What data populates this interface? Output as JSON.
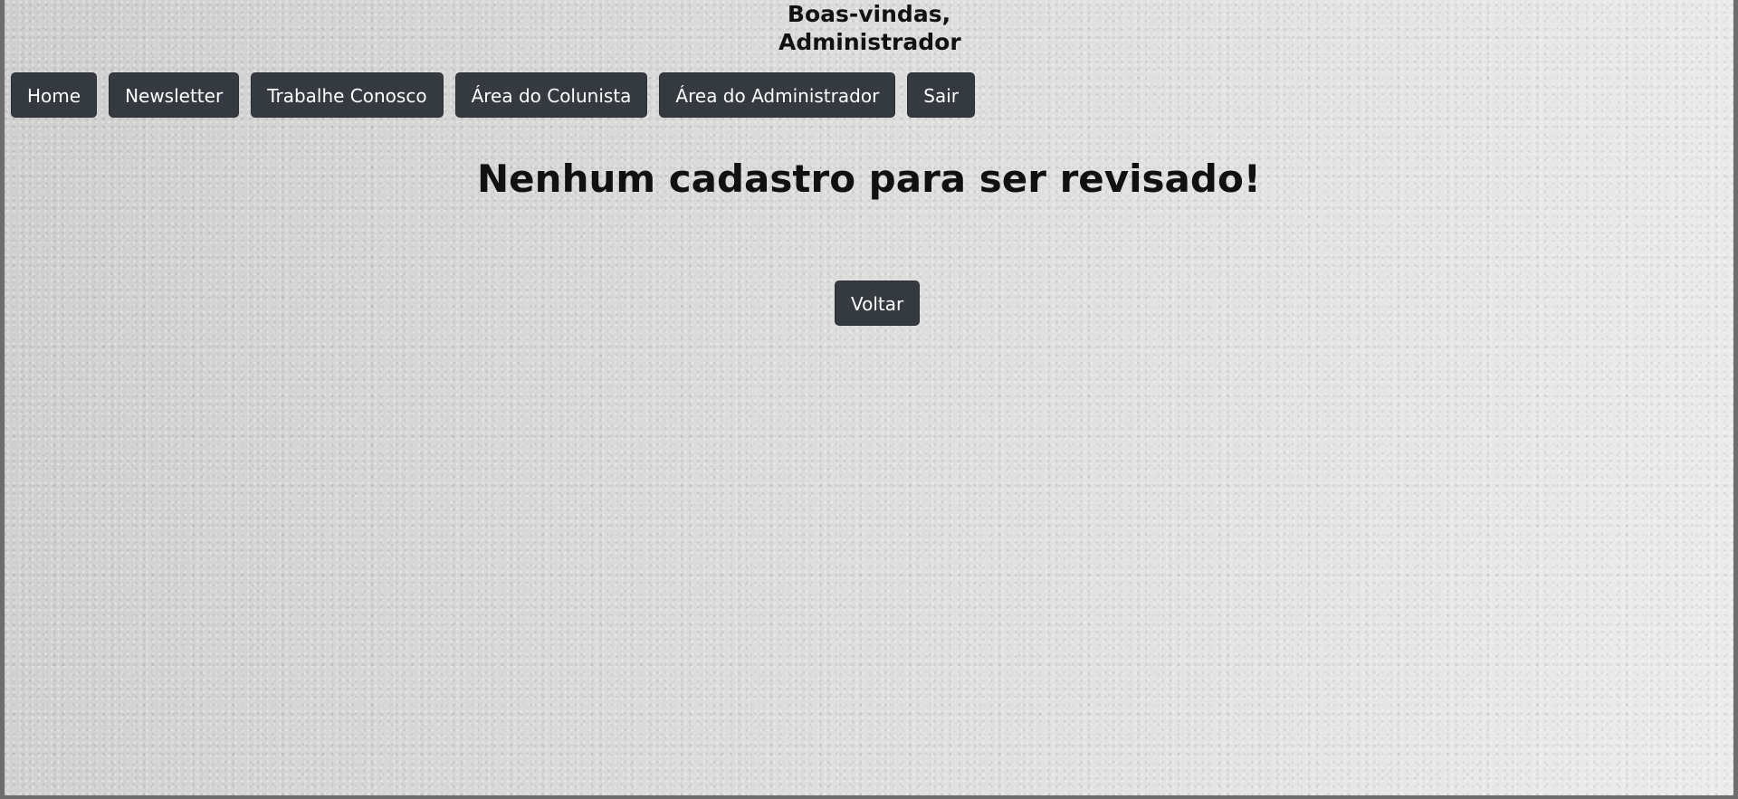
{
  "header": {
    "welcome_line1": "Boas-vindas,",
    "welcome_line2": "Administrador"
  },
  "nav": {
    "items": [
      {
        "label": "Home"
      },
      {
        "label": "Newsletter"
      },
      {
        "label": "Trabalhe Conosco"
      },
      {
        "label": "Área do Colunista"
      },
      {
        "label": "Área do Administrador"
      },
      {
        "label": "Sair"
      }
    ]
  },
  "main": {
    "message": "Nenhum cadastro para ser revisado!",
    "back_label": "Voltar"
  },
  "colors": {
    "button_bg": "#343a40",
    "button_text": "#ffffff",
    "text": "#111111"
  }
}
